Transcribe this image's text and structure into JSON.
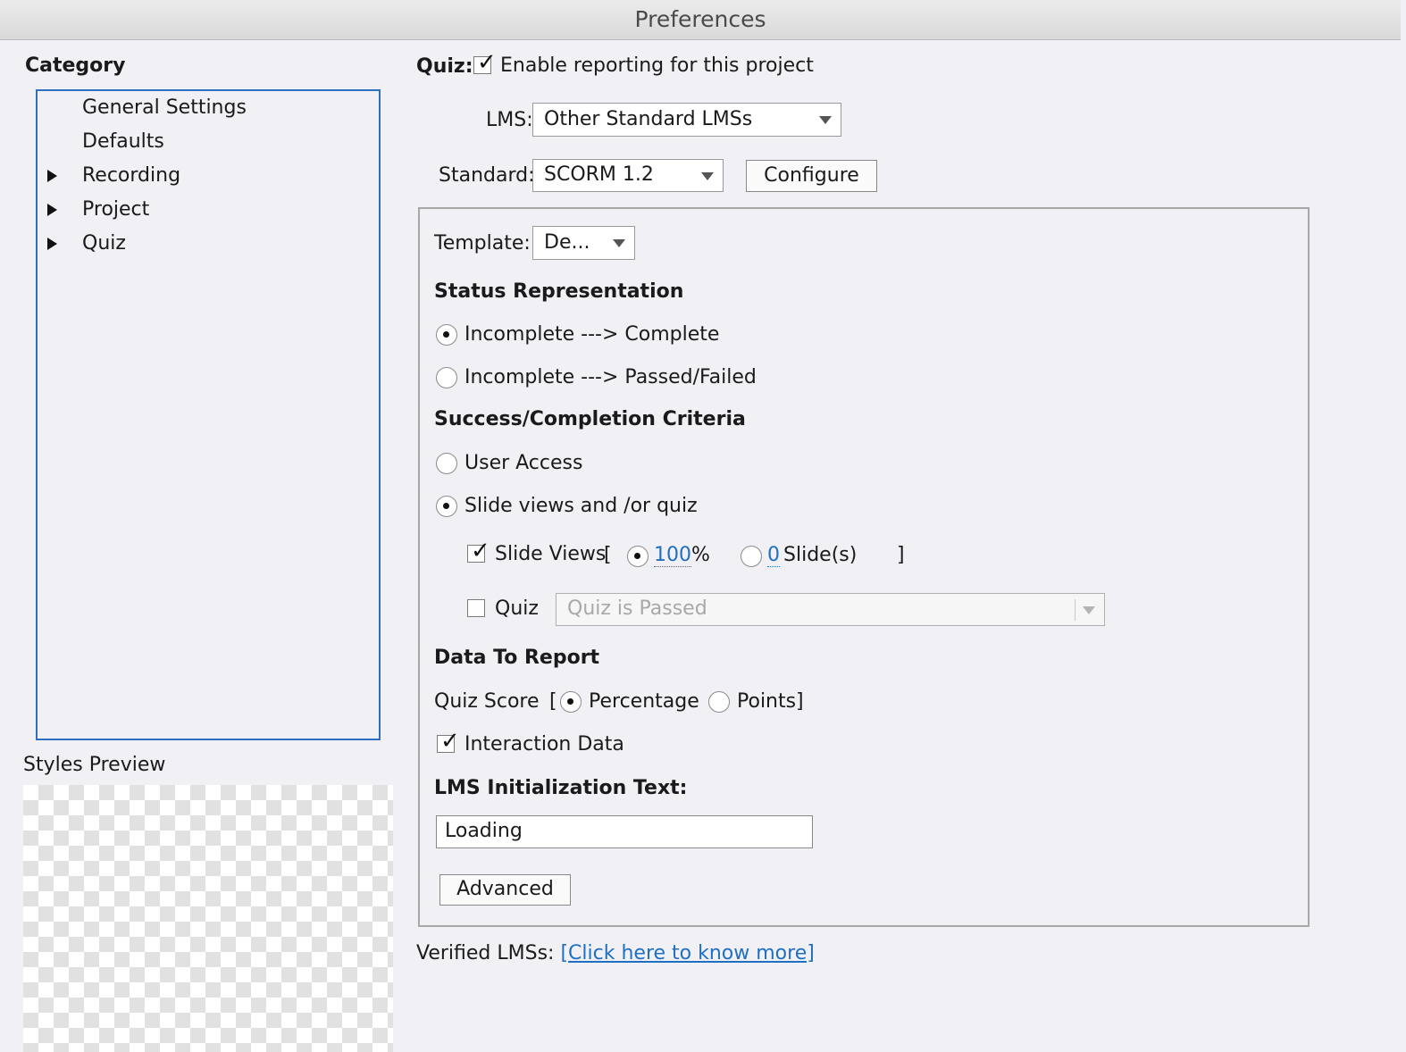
{
  "window": {
    "title": "Preferences"
  },
  "sidebar": {
    "heading": "Category",
    "items": [
      {
        "label": "General Settings",
        "expandable": false
      },
      {
        "label": "Defaults",
        "expandable": false
      },
      {
        "label": "Recording",
        "expandable": true
      },
      {
        "label": "Project",
        "expandable": true
      },
      {
        "label": "Quiz",
        "expandable": true
      }
    ],
    "styles_preview_label": "Styles Preview"
  },
  "quiz": {
    "label": "Quiz:",
    "enable_reporting_label": "Enable reporting for this project",
    "enable_reporting_checked": true,
    "lms_label": "LMS:",
    "lms_value": "Other Standard LMSs",
    "standard_label": "Standard:",
    "standard_value": "SCORM 1.2",
    "configure_label": "Configure"
  },
  "panel": {
    "template_label": "Template:",
    "template_value": "De...",
    "status_heading": "Status Representation",
    "status_options": [
      {
        "label": "Incomplete ---> Complete",
        "selected": true
      },
      {
        "label": "Incomplete ---> Passed/Failed",
        "selected": false
      }
    ],
    "criteria_heading": "Success/Completion Criteria",
    "criteria_options": [
      {
        "label": "User Access",
        "selected": false
      },
      {
        "label": "Slide views and /or quiz",
        "selected": true
      }
    ],
    "slide_views": {
      "label": "Slide Views",
      "checked": true,
      "bracket_open": "[",
      "bracket_close": "]",
      "percent_value": "100",
      "percent_unit": "%",
      "percent_selected": true,
      "slides_value": "0",
      "slides_unit": "Slide(s)",
      "slides_selected": false
    },
    "quiz_criteria": {
      "label": "Quiz",
      "checked": false,
      "select_value": "Quiz is Passed"
    },
    "data_heading": "Data To Report",
    "quiz_score": {
      "label": "Quiz Score",
      "bracket_open": "[",
      "bracket_close": "]",
      "options": [
        {
          "label": "Percentage",
          "selected": true
        },
        {
          "label": "Points",
          "selected": false
        }
      ]
    },
    "interaction_data_label": "Interaction Data",
    "interaction_data_checked": true,
    "init_text_heading": "LMS Initialization Text:",
    "init_text_value": "Loading",
    "advanced_label": "Advanced"
  },
  "footer": {
    "verified_label": "Verified LMSs:",
    "verified_link": "[Click here to know more]"
  },
  "colors": {
    "accent": "#2f6fc2",
    "link": "#1f6fc2",
    "background": "#f0f0f5"
  }
}
